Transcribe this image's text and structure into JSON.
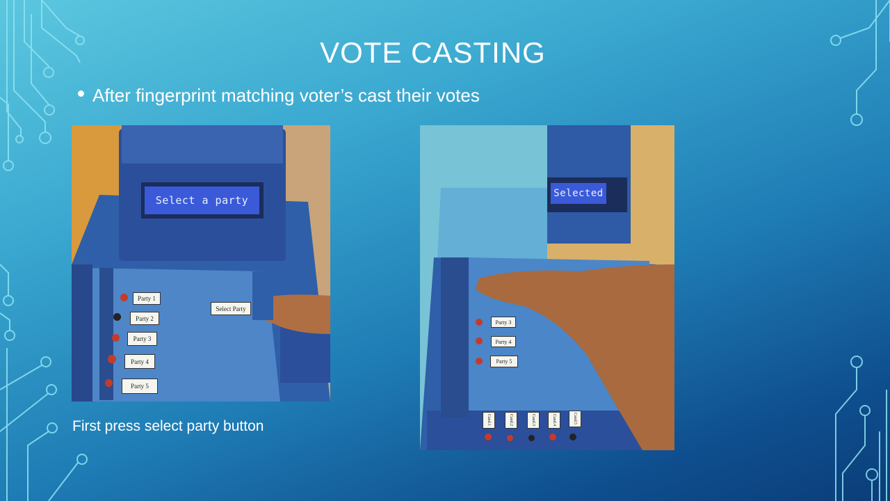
{
  "slide": {
    "title": "VOTE CASTING",
    "bullet": "After fingerprint matching voter’s cast their votes",
    "caption": "First press select party button"
  },
  "photo_left": {
    "lcd_text": "Select a party",
    "party_labels": [
      "Party 1",
      "Party 2",
      "Party 3",
      "Party 4",
      "Party 5"
    ],
    "select_label": "Select Party"
  },
  "photo_right": {
    "lcd_text": "Selected",
    "party_labels": [
      "Party 3",
      "Party 4",
      "Party 5"
    ],
    "bottom_labels": [
      "Cand.1",
      "Cand.2",
      "Cand.3",
      "Cand.4",
      "Cand.5"
    ]
  },
  "colors": {
    "background_top": "#5cc7df",
    "background_bottom": "#0b3d78",
    "circuit_line": "#8fe3f2",
    "device_blue": "#2e5fae",
    "lcd_blue": "#3a5ad8"
  },
  "icons": [
    "circuit-decoration-left",
    "circuit-decoration-right"
  ]
}
